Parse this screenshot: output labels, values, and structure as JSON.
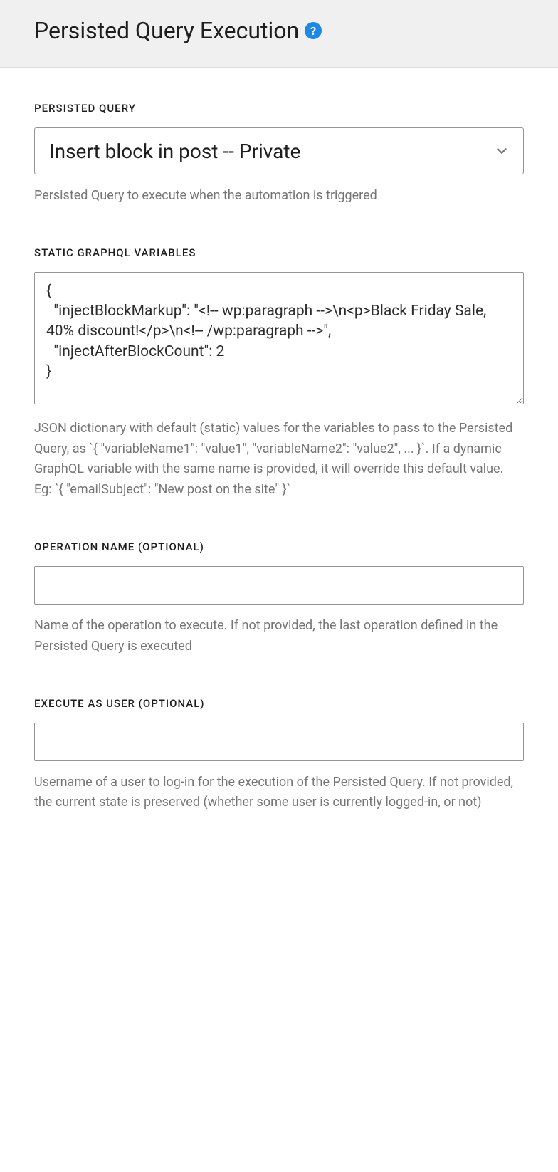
{
  "header": {
    "title": "Persisted Query Execution"
  },
  "fields": {
    "persisted_query": {
      "label": "PERSISTED QUERY",
      "value": "Insert block in post -- Private",
      "help": "Persisted Query to execute when the automation is triggered"
    },
    "static_vars": {
      "label": "STATIC GRAPHQL VARIABLES",
      "value": "{\n  \"injectBlockMarkup\": \"<!-- wp:paragraph -->\\n<p>Black Friday Sale, 40% discount!</p>\\n<!-- /wp:paragraph -->\",\n  \"injectAfterBlockCount\": 2\n}",
      "help": "JSON dictionary with default (static) values for the variables to pass to the Persisted Query, as `{ \"variableName1\": \"value1\", \"variableName2\": \"value2\", ... }`. If a dynamic GraphQL variable with the same name is provided, it will override this default value. Eg: `{ \"emailSubject\": \"New post on the site\" }`"
    },
    "operation_name": {
      "label": "OPERATION NAME (OPTIONAL)",
      "value": "",
      "help": "Name of the operation to execute. If not provided, the last operation defined in the Persisted Query is executed"
    },
    "execute_as_user": {
      "label": "EXECUTE AS USER (OPTIONAL)",
      "value": "",
      "help": "Username of a user to log-in for the execution of the Persisted Query. If not provided, the current state is preserved (whether some user is currently logged-in, or not)"
    }
  }
}
